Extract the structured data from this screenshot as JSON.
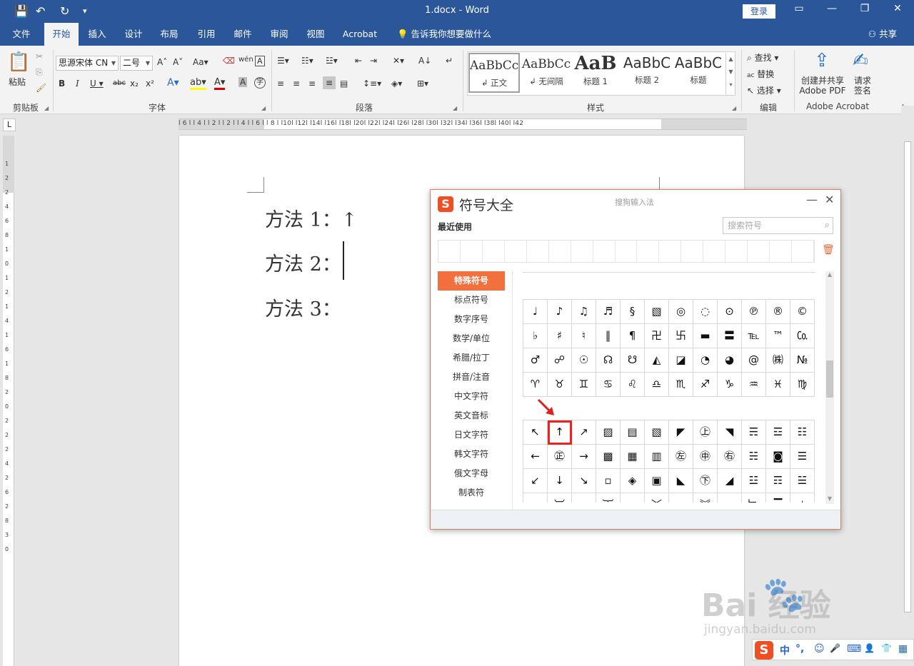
{
  "window": {
    "title": "1.docx  -  Word",
    "login_label": "登录",
    "qa_save": "💾",
    "qa_undo": "↶",
    "qa_redo": "↻",
    "qa_more": "▾"
  },
  "menu": {
    "tabs": [
      {
        "label": "文件"
      },
      {
        "label": "开始",
        "active": true
      },
      {
        "label": "插入"
      },
      {
        "label": "设计"
      },
      {
        "label": "布局"
      },
      {
        "label": "引用"
      },
      {
        "label": "邮件"
      },
      {
        "label": "审阅"
      },
      {
        "label": "视图"
      },
      {
        "label": "Acrobat"
      }
    ],
    "tell_me": "告诉我你想要做什么",
    "share": "共享"
  },
  "ribbon": {
    "clipboard": {
      "paste": "粘贴",
      "label": "剪贴板"
    },
    "font": {
      "name": "思源宋体 CN",
      "size": "二号",
      "label": "字体"
    },
    "paragraph": {
      "label": "段落"
    },
    "styles": {
      "label": "样式",
      "items": [
        {
          "sample": "AaBbCc",
          "name": "↲ 正文"
        },
        {
          "sample": "AaBbCc",
          "name": "↲ 无间隔"
        },
        {
          "sample": "AaB",
          "name": "标题 1"
        },
        {
          "sample": "AaBbC",
          "name": "标题 2"
        },
        {
          "sample": "AaBbC",
          "name": "标题"
        }
      ]
    },
    "editing": {
      "find": "查找",
      "replace": "替换",
      "select": "选择",
      "label": "编辑"
    },
    "acrobat": {
      "create_pdf_line1": "创建并共享",
      "create_pdf_line2": "Adobe PDF",
      "sign_line1": "请求",
      "sign_line2": "签名",
      "label": "Adobe Acrobat"
    }
  },
  "ruler": {
    "numbers": "l 6 l  l 4 l  l 2 l     l 2 l  l 4 l  l 6 l  l 8 l  l10l  l12l  l14l  l16l  l18l  l20l  l22l  l24l  l26l  l28l  l30l  l32l  l34l  l36l  l38l  l40l  l42",
    "vertical": "12 2 4 6 8 10 12 14 16 18 20 22 24 26 28 30"
  },
  "document": {
    "lines": [
      {
        "text": "方法 1：↑"
      },
      {
        "text": "方法 2："
      },
      {
        "text": "方法 3："
      }
    ]
  },
  "symbol_dialog": {
    "title": "符号大全",
    "brand": "搜狗输入法",
    "recent_label": "最近使用",
    "search_placeholder": "搜索符号",
    "categories": [
      {
        "label": "特殊符号",
        "active": true
      },
      {
        "label": "标点符号"
      },
      {
        "label": "数字序号"
      },
      {
        "label": "数学/单位"
      },
      {
        "label": "希腊/拉丁"
      },
      {
        "label": "拼音/注音"
      },
      {
        "label": "中文字符"
      },
      {
        "label": "英文音标"
      },
      {
        "label": "日文字符"
      },
      {
        "label": "韩文字符"
      },
      {
        "label": "俄文字母"
      },
      {
        "label": "制表符"
      }
    ],
    "grid1": [
      "♩",
      "♪",
      "♫",
      "♬",
      "§",
      "▧",
      "◎",
      "◌",
      "⊙",
      "℗",
      "®",
      "©",
      "♭",
      "♯",
      "♮",
      "‖",
      "¶",
      "卍",
      "卐",
      "▬",
      "〓",
      "℡",
      "™",
      "㏇",
      "♂",
      "☍",
      "☉",
      "☊",
      "☋",
      "◭",
      "◪",
      "◔",
      "◕",
      "@",
      "㈱",
      "№",
      "♈",
      "♉",
      "♊",
      "♋",
      "♌",
      "♎",
      "♏",
      "♐",
      "♑",
      "♒",
      "♓",
      "♍"
    ],
    "grid2": [
      "↖",
      "↑",
      "↗",
      "▨",
      "▤",
      "▧",
      "◤",
      "㊤",
      "◥",
      "☴",
      "☲",
      "☷",
      "←",
      "㊣",
      "→",
      "▩",
      "▦",
      "▥",
      "㊧",
      "㊥",
      "㊨",
      "☵",
      "◙",
      "☰",
      "↙",
      "↓",
      "↘",
      "▫",
      "◈",
      "▣",
      "◣",
      "㊦",
      "◢",
      "☳",
      "☶",
      "☱",
      "︹",
      "︺",
      "︷",
      "︸",
      "︿",
      "﹀",
      "︽",
      "︾",
      "﹁",
      "﹂",
      "▔",
      "⊥"
    ],
    "highlighted_symbol": "↑"
  },
  "ime": {
    "logo": "S",
    "lang": "中",
    "punct": "°,",
    "emoji": "☺",
    "voice": "🎤",
    "keyboard": "⌨",
    "user": "👤",
    "skin": "👕",
    "apps": "▦"
  },
  "watermark": {
    "main": "Bai   经验",
    "sub": "jingyan.baidu.com"
  }
}
